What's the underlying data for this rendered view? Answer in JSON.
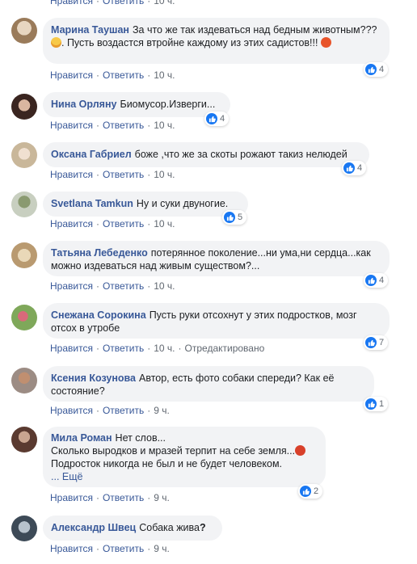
{
  "actions": {
    "like": "Нравится",
    "reply": "Ответить",
    "edited": "Отредактировано"
  },
  "top_partial": {
    "time": "10 ч."
  },
  "comments": [
    {
      "author": "Марина Таушан",
      "text_a": "За что же так издеваться над бедным животным???",
      "text_b": ". Пусть воздастся втройне каждому из этих садистов!!!",
      "time": "10 ч.",
      "likes": "4"
    },
    {
      "author": "Нина Орляну",
      "text": "Биомусор.Изверги...",
      "time": "10 ч.",
      "likes": "4"
    },
    {
      "author": "Оксана Габриел",
      "text": "боже ,что же за скоты рожают такиз нелюдей",
      "time": "10 ч.",
      "likes": "4"
    },
    {
      "author": "Svetlana Tamkun",
      "text": "Ну и суки двуногие.",
      "time": "10 ч.",
      "likes": "5"
    },
    {
      "author": "Татьяна Лебеденко",
      "text": "потерянное поколение...ни ума,ни сердца...как можно издеваться над живым существом?...",
      "time": "10 ч.",
      "likes": "4"
    },
    {
      "author": "Снежана Сорокина",
      "text": "Пусть руки отсохнут у этих подростков, мозг отсох в утробе",
      "time": "10 ч.",
      "likes": "7"
    },
    {
      "author": "Ксения Козунова",
      "text": "Автор, есть фото собаки спереди? Как её состояние?",
      "time": "9 ч.",
      "likes": "1"
    },
    {
      "author": "Мила Роман",
      "text_a": "Нет слов...",
      "text_b": "Сколько выродков и мразей терпит на себе земля...",
      "text_c": "Подросток никогда не был и не будет человеком.",
      "more": "... Ещё",
      "time": "9 ч.",
      "likes": "2"
    },
    {
      "author": "Александр Швец",
      "text": "Собака жива",
      "text_q": "?",
      "time": "9 ч."
    }
  ],
  "colors": {
    "link": "#385898",
    "bubble": "#f2f3f5",
    "like_blue": "#1877f2",
    "meta": "#606770"
  },
  "icons": [
    "like-icon",
    "crying-emoji-icon",
    "angry-emoji-icon",
    "cursing-emoji-icon"
  ]
}
